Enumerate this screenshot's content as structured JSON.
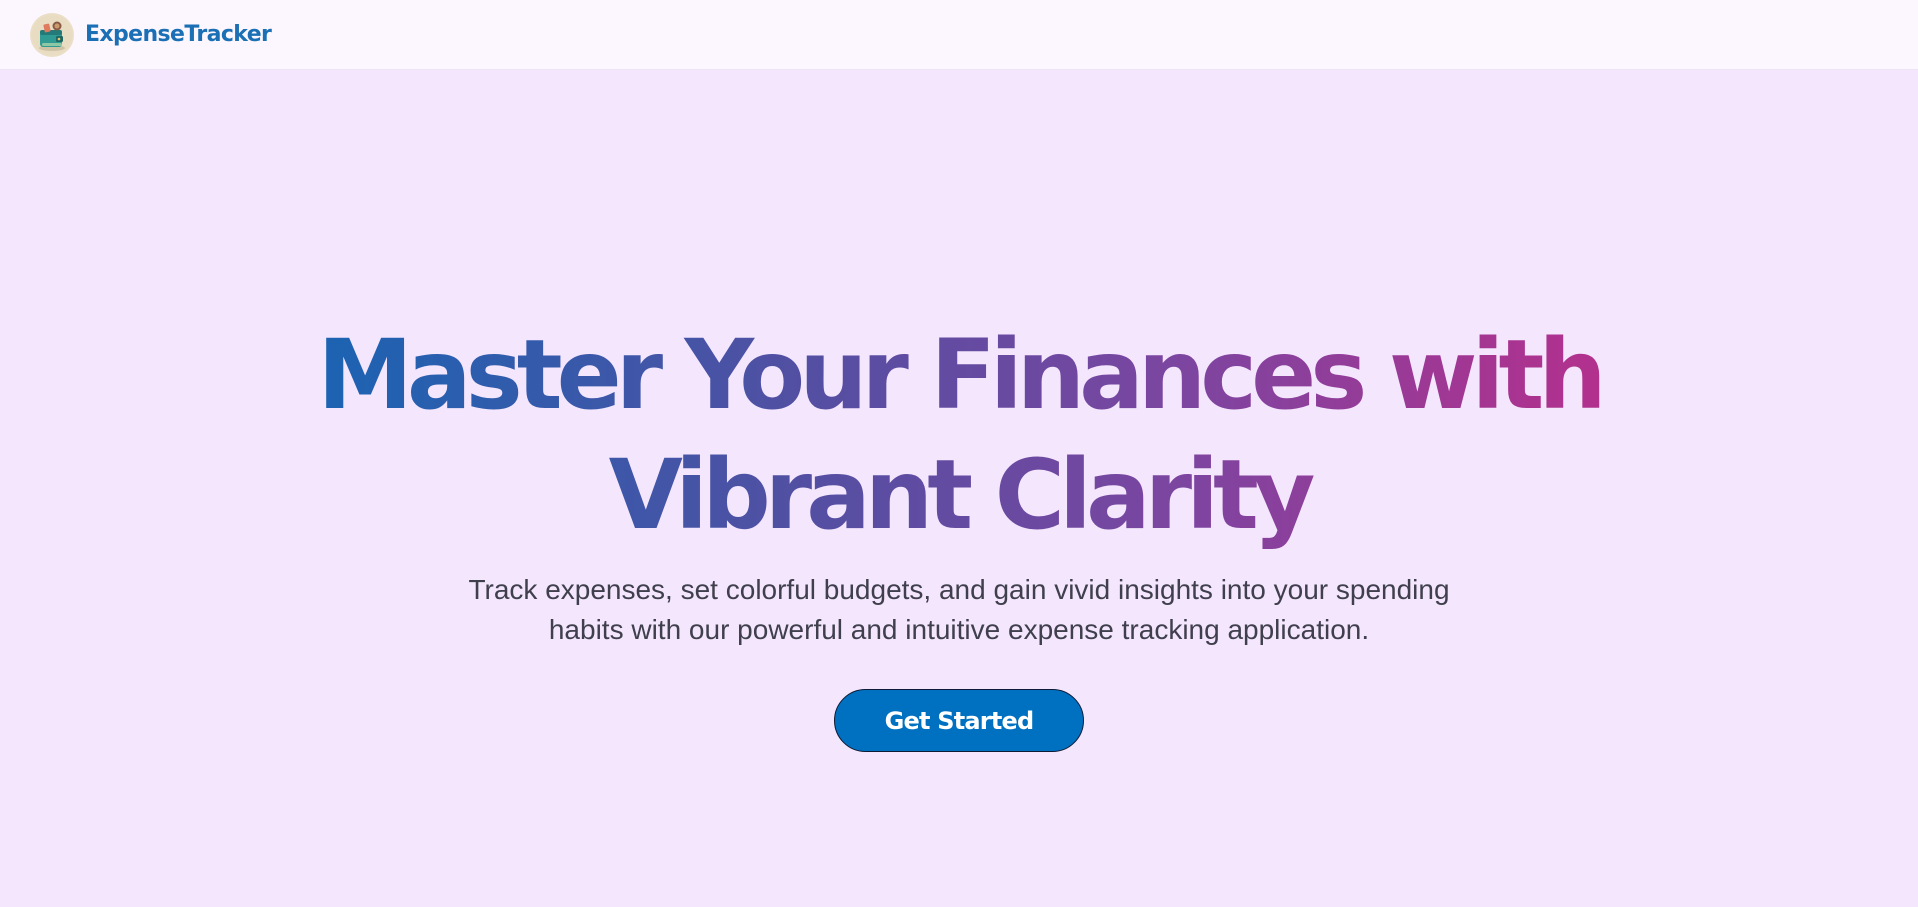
{
  "navbar": {
    "brand": "ExpenseTracker",
    "logo_icon": "wallet-icon"
  },
  "hero": {
    "headline_line1": "Master Your Finances with",
    "headline_line2": "Vibrant Clarity",
    "subtitle_line1": "Track expenses, set colorful budgets, and gain vivid insights into your spending",
    "subtitle_line2": "habits with our powerful and intuitive expense tracking application.",
    "cta_label": "Get Started"
  },
  "colors": {
    "page_background": "#f4e6fd",
    "navbar_background": "#fcf7fe",
    "brand": "#1b6fb5",
    "gradient_start": "#1568b4",
    "gradient_end": "#d3287f",
    "button": "#0070c0",
    "button_border": "#0d1b36"
  }
}
